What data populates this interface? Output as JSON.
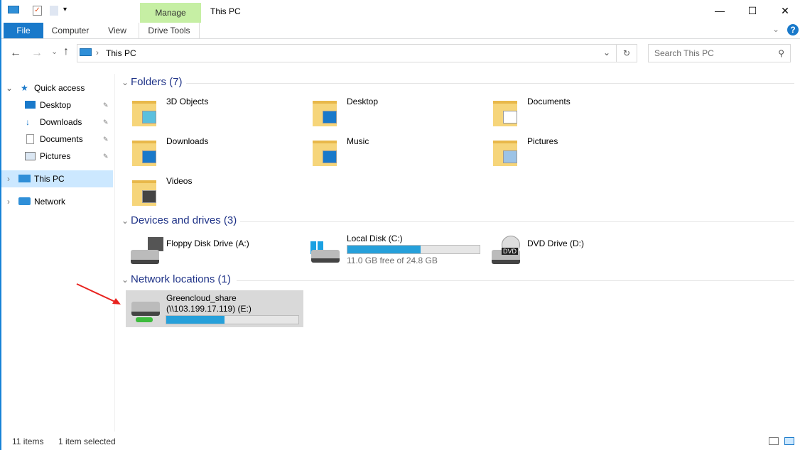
{
  "window": {
    "title": "This PC",
    "manage_label": "Manage",
    "minimize": "—",
    "maximize": "☐",
    "close": "✕"
  },
  "ribbon": {
    "tabs": [
      "File",
      "Computer",
      "View",
      "Drive Tools"
    ],
    "help": "?",
    "collapse": "⌄"
  },
  "nav": {
    "back": "←",
    "forward": "→",
    "recent": "⌄",
    "up": "↑",
    "path": "This PC",
    "sep": "›",
    "refresh": "↻",
    "search_placeholder": "Search This PC",
    "dropdown": "⌄"
  },
  "sidebar": {
    "items": [
      {
        "label": "Quick access",
        "chev": "⌄"
      },
      {
        "label": "Desktop",
        "pin": "📌"
      },
      {
        "label": "Downloads",
        "pin": "📌"
      },
      {
        "label": "Documents",
        "pin": "📌"
      },
      {
        "label": "Pictures",
        "pin": "📌"
      },
      {
        "label": "This PC",
        "chev": "›"
      },
      {
        "label": "Network",
        "chev": "›"
      }
    ]
  },
  "sections": {
    "folders": "Folders (7)",
    "devices": "Devices and drives (3)",
    "network": "Network locations (1)"
  },
  "folders": [
    "3D Objects",
    "Desktop",
    "Documents",
    "Downloads",
    "Music",
    "Pictures",
    "Videos"
  ],
  "drives": [
    {
      "name": "Floppy Disk Drive (A:)"
    },
    {
      "name": "Local Disk (C:)",
      "free_text": "11.0 GB free of 24.8 GB",
      "used_percent": 55.6
    },
    {
      "name": "DVD Drive (D:)",
      "badge": "DVD"
    }
  ],
  "network": {
    "name": "Greencloud_share",
    "path": "(\\\\103.199.17.119) (E:)",
    "used_percent": 44
  },
  "status": {
    "items": "11 items",
    "selected": "1 item selected"
  },
  "colors": {
    "accent": "#1979ca",
    "manage": "#c6efa4",
    "bar": "#26a0da",
    "selection": "#cce8ff",
    "arrow": "#e8231f"
  }
}
